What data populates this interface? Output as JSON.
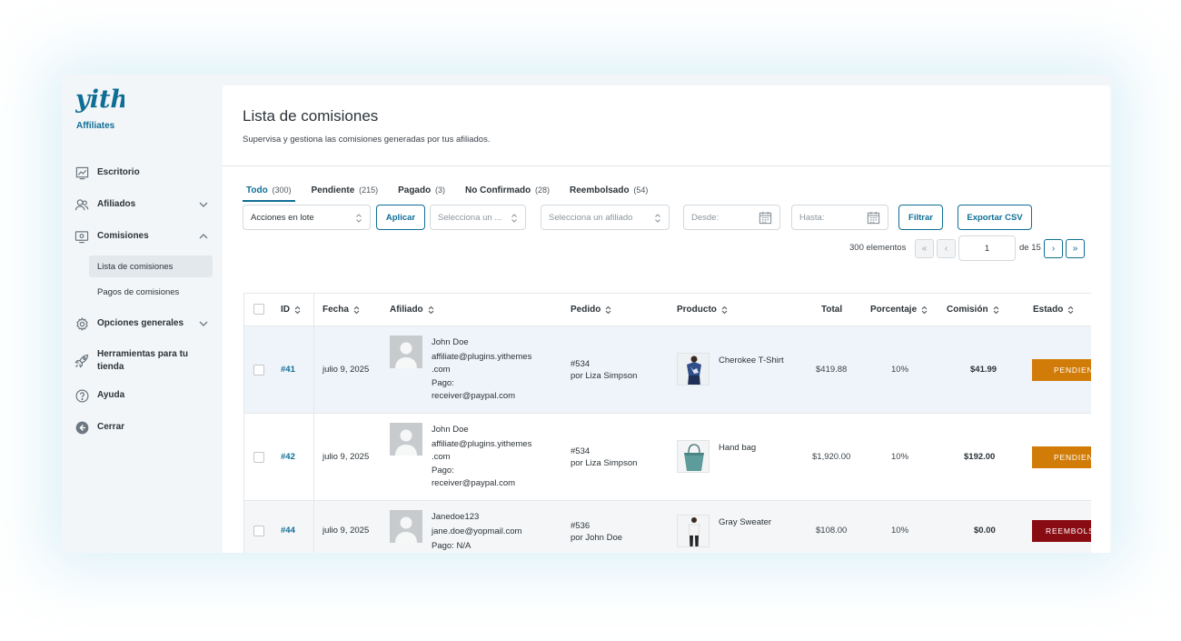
{
  "brand": {
    "logo_text": "yith",
    "label": "Affiliates"
  },
  "sidebar": {
    "items": [
      {
        "label": "Escritorio",
        "icon": "dashboard-chart-icon"
      },
      {
        "label": "Afiliados",
        "icon": "users-icon"
      },
      {
        "label": "Comisiones",
        "icon": "commissions-icon"
      },
      {
        "label": "Opciones generales",
        "icon": "gear-icon"
      },
      {
        "label": "Herramientas para tu tienda",
        "icon": "rocket-icon"
      },
      {
        "label": "Ayuda",
        "icon": "help-icon"
      },
      {
        "label": "Cerrar",
        "icon": "back-arrow-icon"
      }
    ],
    "subitems": [
      {
        "label": "Lista de comisiones",
        "active": true
      },
      {
        "label": "Pagos de comisiones",
        "active": false
      }
    ]
  },
  "page": {
    "title": "Lista de comisiones",
    "description": "Supervisa y gestiona las comisiones generadas por tus afiliados."
  },
  "tabs": [
    {
      "label": "Todo",
      "count": "(300)",
      "active": true
    },
    {
      "label": "Pendiente",
      "count": "(215)"
    },
    {
      "label": "Pagado",
      "count": "(3)"
    },
    {
      "label": "No Confirmado",
      "count": "(28)"
    },
    {
      "label": "Reembolsado",
      "count": "(54)"
    }
  ],
  "filters": {
    "bulk_actions": "Acciones en lote",
    "apply": "Aplicar",
    "select_status": "Selecciona un ...",
    "select_affiliate": "Selecciona un afiliado",
    "from_placeholder": "Desde:",
    "to_placeholder": "Hasta:",
    "filter": "Filtrar",
    "export": "Exportar CSV"
  },
  "pagination": {
    "items_count": "300 elementos",
    "first": "«",
    "prev": "‹",
    "current": "1",
    "of_label": "de 15",
    "next": "›",
    "last": "»"
  },
  "table": {
    "headers": {
      "id": "ID",
      "date": "Fecha",
      "affiliate": "Afiliado",
      "order": "Pedido",
      "product": "Producto",
      "total": "Total",
      "percentage": "Porcentaje",
      "commission": "Comisión",
      "status": "Estado"
    },
    "rows": [
      {
        "id": "#41",
        "date": "julio 9, 2025",
        "aff_name": "John Doe",
        "aff_email_1": "affiliate@plugins.yithemes",
        "aff_email_2": ".com",
        "pay_label": "Pago:",
        "pay_value": "receiver@paypal.com",
        "order": "#534",
        "order_by": "por Liza Simpson",
        "product": "Cherokee T-Shirt",
        "total": "$419.88",
        "percentage": "10%",
        "commission": "$41.99",
        "status": "PENDIENTE"
      },
      {
        "id": "#42",
        "date": "julio 9, 2025",
        "aff_name": "John Doe",
        "aff_email_1": "affiliate@plugins.yithemes",
        "aff_email_2": ".com",
        "pay_label": "Pago:",
        "pay_value": "receiver@paypal.com",
        "order": "#534",
        "order_by": "por Liza Simpson",
        "product": "Hand bag",
        "total": "$1,920.00",
        "percentage": "10%",
        "commission": "$192.00",
        "status": "PENDIENTE"
      },
      {
        "id": "#44",
        "date": "julio 9, 2025",
        "aff_name": "Janedoe123",
        "aff_email_1": "jane.doe@yopmail.com",
        "pay_label": "Pago: N/A",
        "order": "#536",
        "order_by": "por John Doe",
        "product": "Gray Sweater",
        "total": "$108.00",
        "percentage": "10%",
        "commission": "$0.00",
        "status": "REEMBOLSADO"
      }
    ]
  },
  "colors": {
    "accent": "#0f6e95",
    "pending": "#d17c08",
    "refunded": "#8a0c13",
    "row_highlight": "#eef4f9"
  }
}
